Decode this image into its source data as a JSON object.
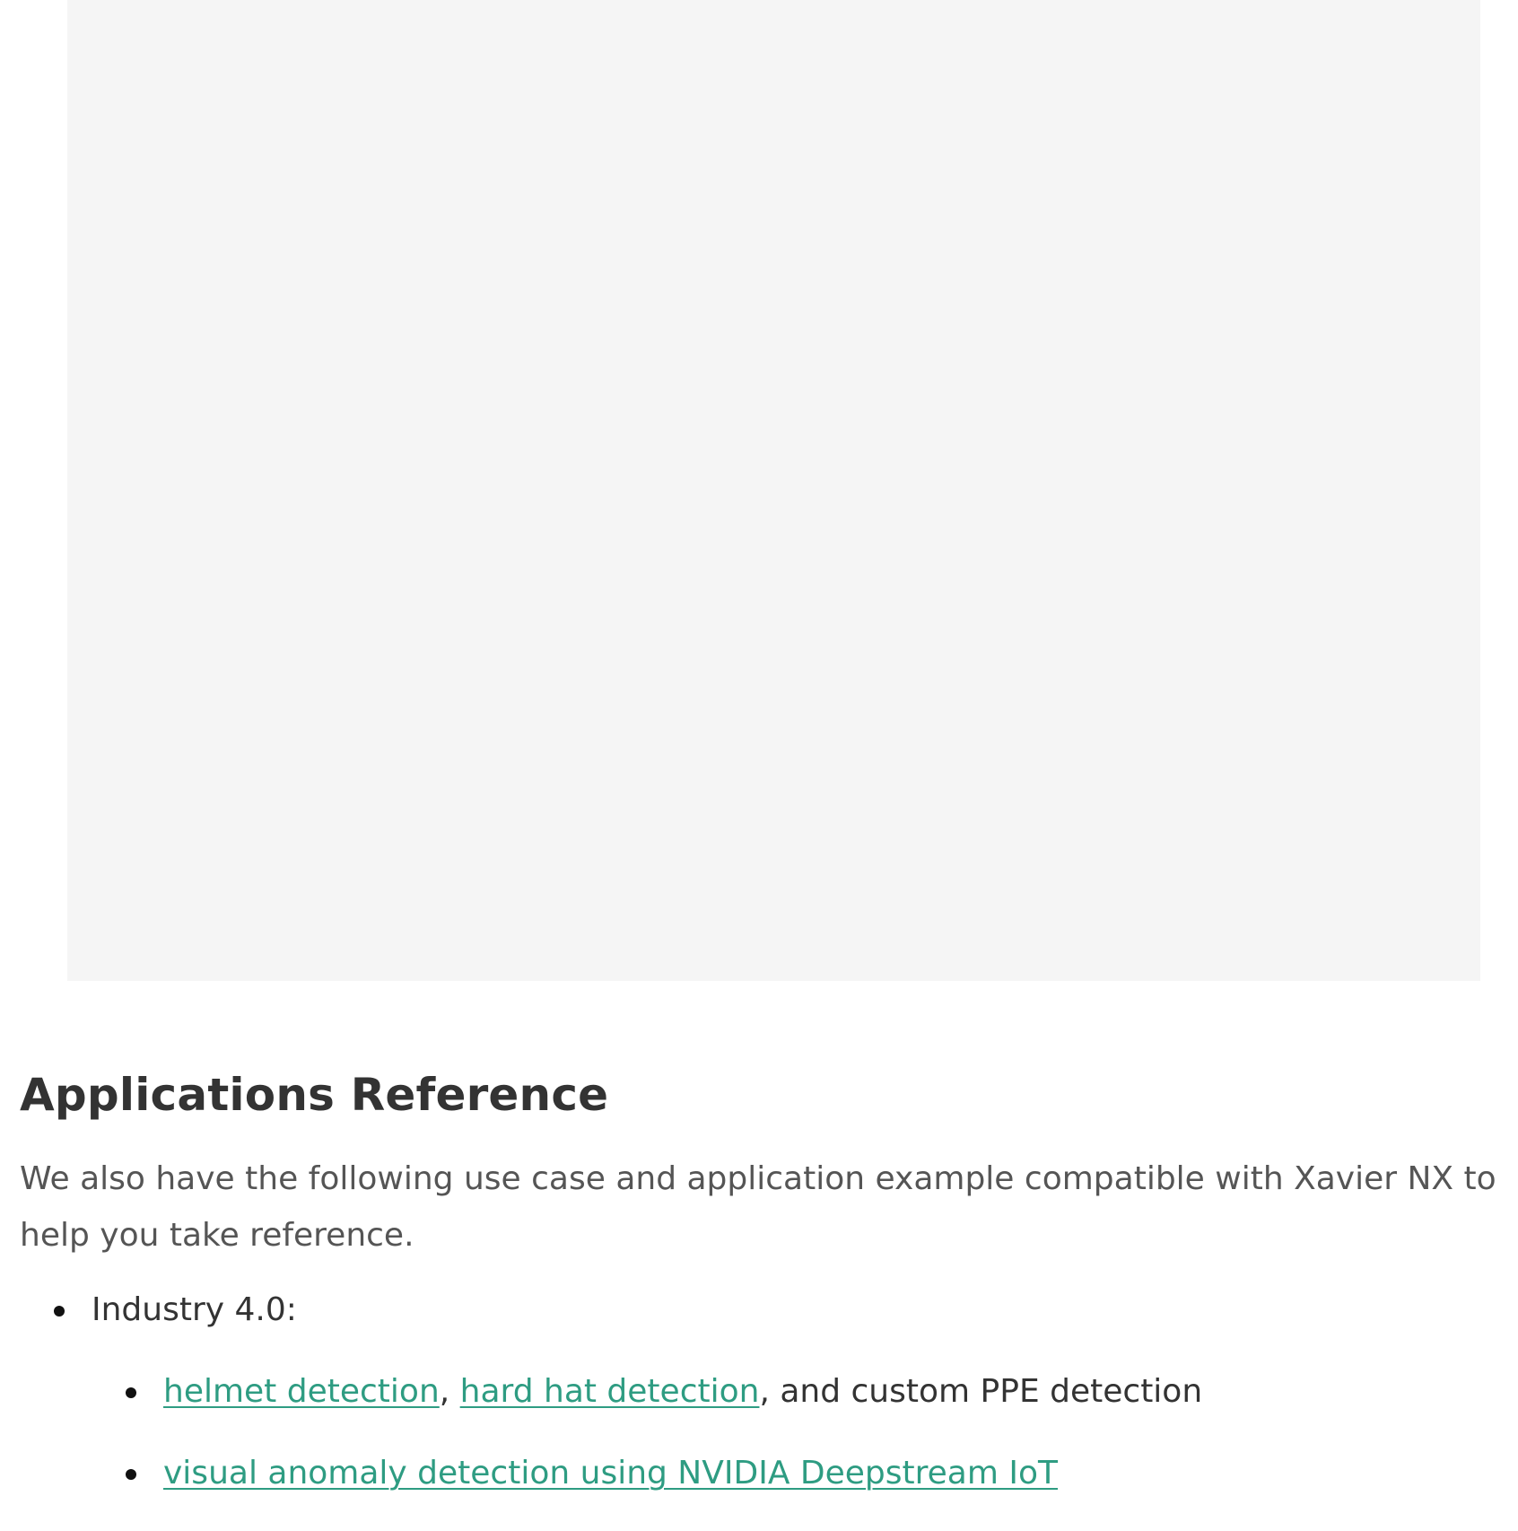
{
  "section": {
    "title": "Applications Reference",
    "intro": "We also have the following use case and application example compatible with Xavier NX to help you take reference."
  },
  "list": {
    "item1": {
      "label": "Industry 4.0:",
      "sub1": {
        "link1": "helmet detection",
        "sep": ", ",
        "link2": "hard hat detection",
        "rest": ", and custom PPE detection"
      },
      "sub2": {
        "link": "visual anomaly detection using NVIDIA Deepstream IoT"
      }
    }
  },
  "colors": {
    "link": "#2e9c82",
    "placeholder": "#f5f5f5",
    "heading": "#333333"
  }
}
